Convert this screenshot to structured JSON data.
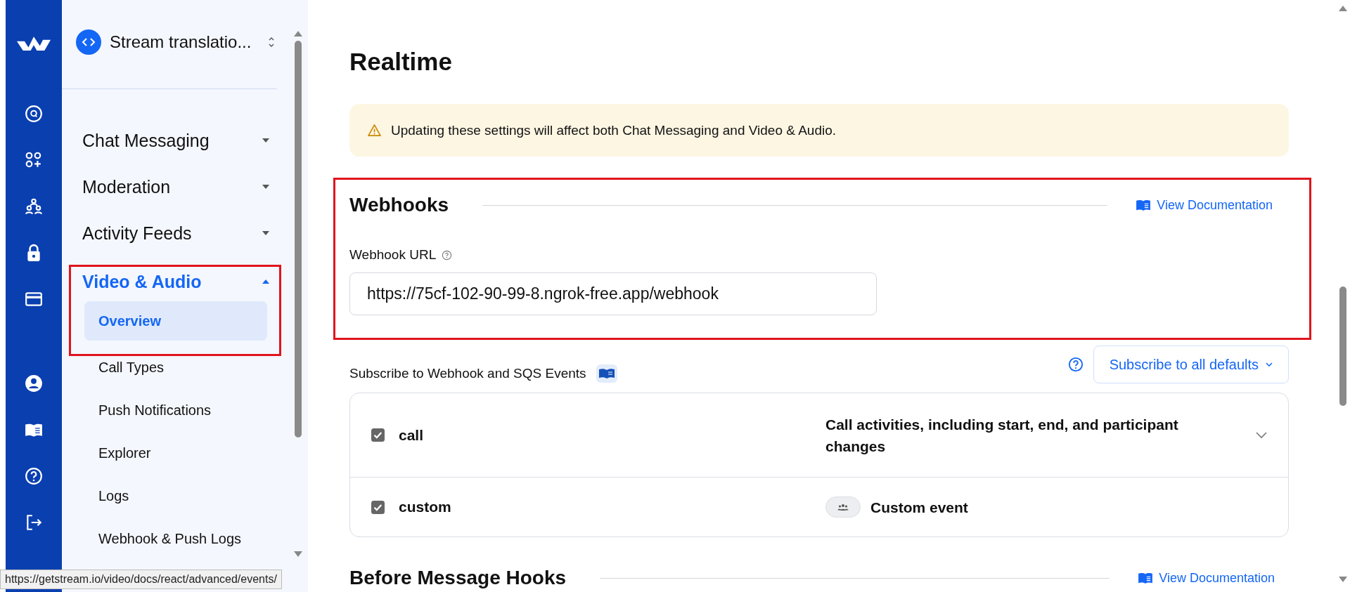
{
  "project": {
    "name": "Stream translatio..."
  },
  "nav": [
    {
      "label": "Chat Messaging",
      "expanded": false,
      "selected": false,
      "highlighted": false
    },
    {
      "label": "Moderation",
      "expanded": false,
      "selected": false,
      "highlighted": false
    },
    {
      "label": "Activity Feeds",
      "expanded": false,
      "selected": false,
      "highlighted": false
    },
    {
      "label": "Video & Audio",
      "expanded": true,
      "selected": true,
      "highlighted": true,
      "children": [
        {
          "label": "Overview",
          "selected": true
        },
        {
          "label": "Call Types",
          "selected": false
        },
        {
          "label": "Push Notifications",
          "selected": false
        },
        {
          "label": "Explorer",
          "selected": false
        },
        {
          "label": "Logs",
          "selected": false
        },
        {
          "label": "Webhook & Push Logs",
          "selected": false
        }
      ]
    }
  ],
  "page_title": "Realtime",
  "alert": "Updating these settings will affect both Chat Messaging and Video & Audio.",
  "webhooks": {
    "title": "Webhooks",
    "highlighted": true,
    "doc_link": "View Documentation",
    "url_label": "Webhook URL",
    "url_value": "https://75cf-102-90-99-8.ngrok-free.app/webhook"
  },
  "subscribe": {
    "label": "Subscribe to Webhook and SQS Events",
    "button": "Subscribe to all defaults"
  },
  "events": [
    {
      "kind": "expandable",
      "name": "call",
      "checked": true,
      "description": "Call activities, including start, end, and participant changes"
    },
    {
      "kind": "custom",
      "name": "custom",
      "checked": true,
      "description": "Custom event"
    }
  ],
  "next_section": {
    "title": "Before Message Hooks",
    "doc_link": "View Documentation"
  },
  "status_url": "https://getstream.io/video/docs/react/advanced/events/"
}
